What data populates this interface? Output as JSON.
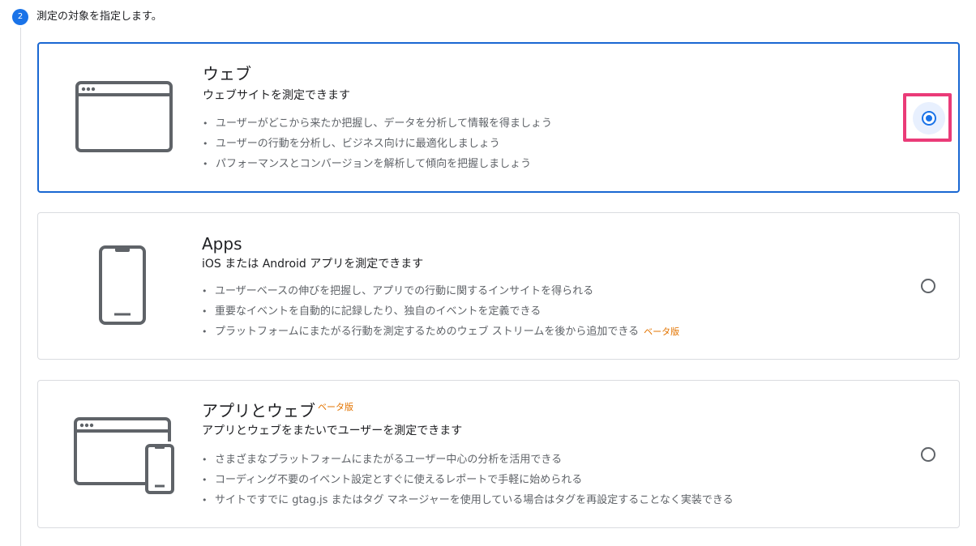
{
  "step": {
    "number": "2",
    "title": "測定の対象を指定します。"
  },
  "options": [
    {
      "title": "ウェブ",
      "subtitle": "ウェブサイトを測定できます",
      "features": [
        "ユーザーがどこから来たか把握し、データを分析して情報を得ましょう",
        "ユーザーの行動を分析し、ビジネス向けに最適化しましょう",
        "パフォーマンスとコンバージョンを解析して傾向を把握しましょう"
      ],
      "selected": true,
      "icon": "browser-window-icon"
    },
    {
      "title": "Apps",
      "subtitle": "iOS または Android アプリを測定できます",
      "features": [
        "ユーザーベースの伸びを把握し、アプリでの行動に関するインサイトを得られる",
        "重要なイベントを自動的に記録したり、独自のイベントを定義できる",
        "プラットフォームにまたがる行動を測定するためのウェブ ストリームを後から追加できる"
      ],
      "feature_badge": "ベータ版",
      "selected": false,
      "icon": "smartphone-icon"
    },
    {
      "title": "アプリとウェブ",
      "title_badge": "ベータ版",
      "subtitle": "アプリとウェブをまたいでユーザーを測定できます",
      "features": [
        "さまざまなプラットフォームにまたがるユーザー中心の分析を活用できる",
        "コーディング不要のイベント設定とすぐに使えるレポートで手軽に始められる",
        "サイトですでに gtag.js またはタグ マネージャーを使用している場合はタグを再設定することなく実装できる"
      ],
      "selected": false,
      "icon": "browser-and-phone-icon"
    }
  ],
  "colors": {
    "accent": "#1a73e8",
    "selected_border": "#1967d2",
    "beta": "#e37400",
    "highlight": "#ea3b78"
  }
}
